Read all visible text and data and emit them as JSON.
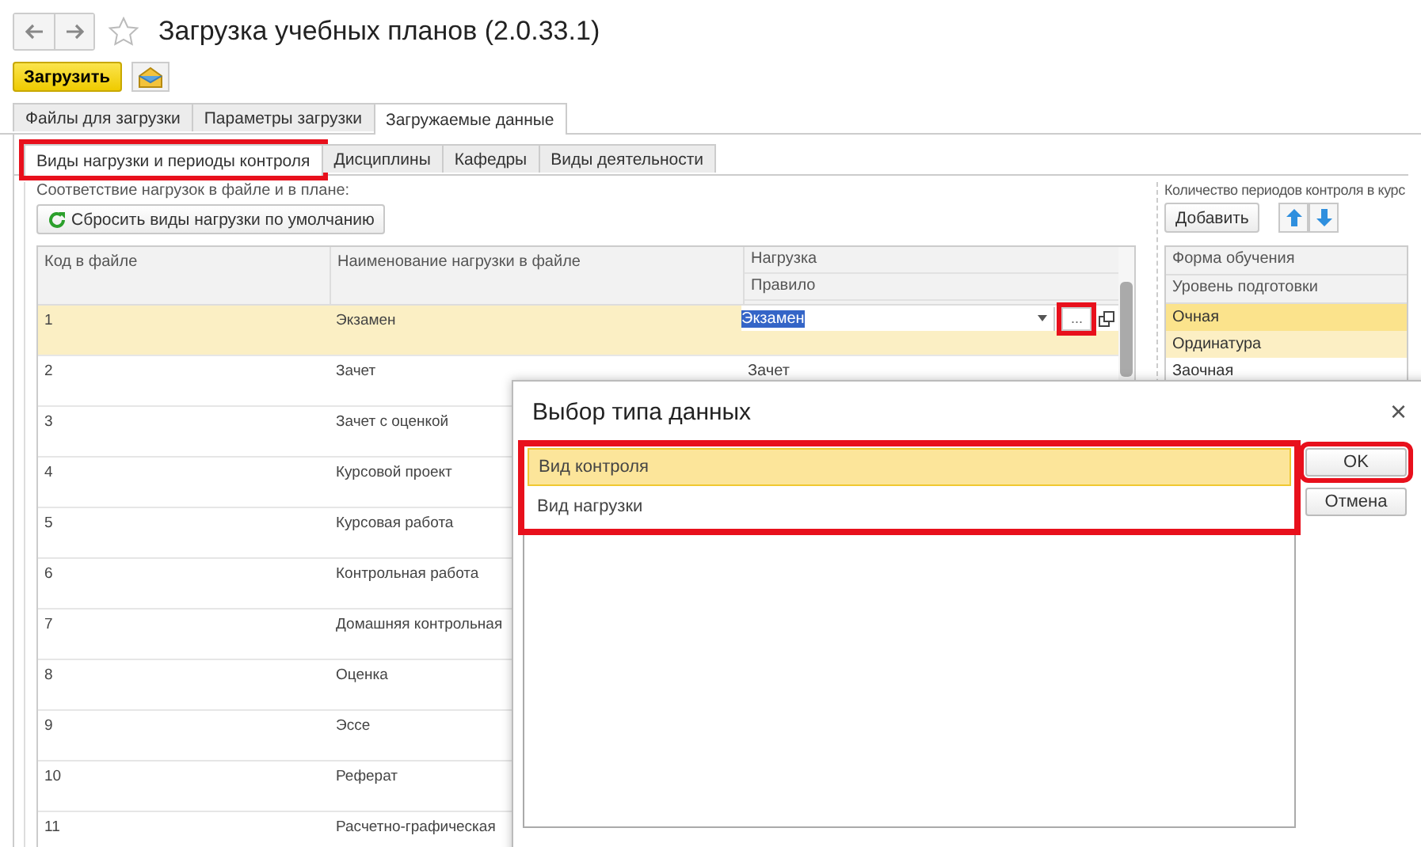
{
  "window": {
    "title": "Загрузка учебных планов (2.0.33.1)"
  },
  "toolbar": {
    "load_button": "Загрузить"
  },
  "tabs": [
    {
      "label": "Файлы для загрузки",
      "selected": false
    },
    {
      "label": "Параметры загрузки",
      "selected": false
    },
    {
      "label": "Загружаемые данные",
      "selected": true
    }
  ],
  "subtabs": [
    {
      "label": "Виды нагрузки и периоды контроля",
      "selected": true,
      "highlighted": true
    },
    {
      "label": "Дисциплины",
      "selected": false,
      "highlighted": false
    },
    {
      "label": "Кафедры",
      "selected": false,
      "highlighted": false
    },
    {
      "label": "Виды деятельности",
      "selected": false,
      "highlighted": false
    }
  ],
  "left": {
    "caption": "Соответствие нагрузок в файле и в плане:",
    "reset_button": "Сбросить виды нагрузки по умолчанию",
    "columns": [
      "Код в файле",
      "Наименование нагрузки в файле",
      "Нагрузка",
      "Правило"
    ],
    "rows": [
      {
        "code": "1",
        "name": "Экзамен",
        "load": "Экзамен",
        "selected": true
      },
      {
        "code": "2",
        "name": "Зачет",
        "load": "Зачет",
        "selected": false
      },
      {
        "code": "3",
        "name": "Зачет с оценкой",
        "selected": false
      },
      {
        "code": "4",
        "name": "Курсовой проект",
        "selected": false
      },
      {
        "code": "5",
        "name": "Курсовая работа",
        "selected": false
      },
      {
        "code": "6",
        "name": "Контрольная работа",
        "selected": false
      },
      {
        "code": "7",
        "name": "Домашняя контрольная",
        "selected": false
      },
      {
        "code": "8",
        "name": "Оценка",
        "selected": false
      },
      {
        "code": "9",
        "name": "Эссе",
        "selected": false
      },
      {
        "code": "10",
        "name": "Реферат",
        "selected": false
      },
      {
        "code": "11",
        "name": "Расчетно-графическая",
        "selected": false
      }
    ],
    "ellipsis_button": {
      "label": "...",
      "highlighted": true
    }
  },
  "right": {
    "caption": "Количество периодов контроля в курс",
    "add_button": "Добавить",
    "columns": [
      "Форма обучения",
      "Уровень подготовки"
    ],
    "rows": [
      {
        "form": "Очная",
        "level": "Ординатура",
        "selected": true
      },
      {
        "form": "Заочная",
        "selected": false
      }
    ]
  },
  "dialog": {
    "title": "Выбор типа данных",
    "close": "×",
    "highlighted": true,
    "items": [
      {
        "label": "Вид контроля",
        "selected": true
      },
      {
        "label": "Вид нагрузки",
        "selected": false
      }
    ],
    "ok_button": {
      "label": "OK",
      "highlighted": true
    },
    "cancel_button": {
      "label": "Отмена",
      "highlighted": false
    }
  }
}
